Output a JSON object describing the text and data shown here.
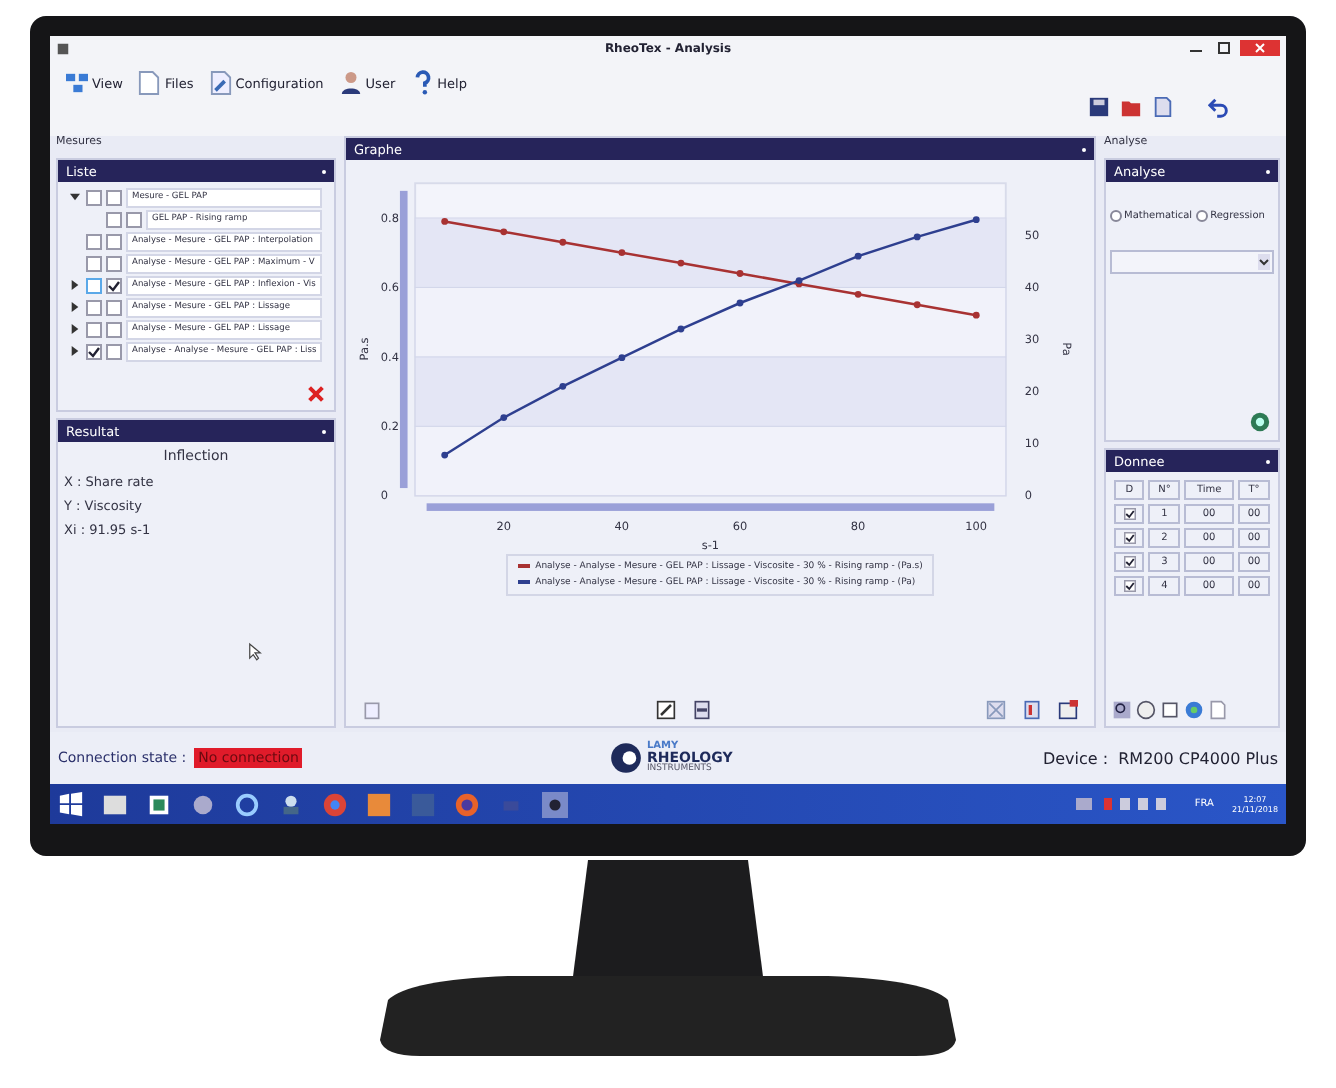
{
  "window": {
    "title": "RheoTex - Analysis"
  },
  "menu": [
    {
      "label": "View"
    },
    {
      "label": "Files"
    },
    {
      "label": "Configuration"
    },
    {
      "label": "User"
    },
    {
      "label": "Help"
    }
  ],
  "mesures_label": "Mesures",
  "liste": {
    "title": "Liste",
    "items": [
      {
        "label": "Mesure - GEL PAP",
        "checks": [
          false,
          false
        ],
        "expanded": true,
        "selected": false,
        "children": [
          {
            "label": "GEL PAP - Rising ramp",
            "checks": [
              false,
              false
            ],
            "selected": false
          }
        ]
      },
      {
        "label": "Analyse - Mesure - GEL PAP : Interpolation",
        "checks": [
          false,
          false
        ],
        "selected": false
      },
      {
        "label": "Analyse - Mesure - GEL PAP : Maximum - V",
        "checks": [
          false,
          false
        ],
        "selected": false
      },
      {
        "label": "Analyse - Mesure - GEL PAP : Inflexion - Vis",
        "checks": [
          false,
          true
        ],
        "expanded": false,
        "selected": true
      },
      {
        "label": "Analyse - Mesure - GEL PAP : Lissage",
        "checks": [
          false,
          false
        ],
        "expanded": false,
        "selected": false
      },
      {
        "label": "Analyse - Mesure - GEL PAP : Lissage",
        "checks": [
          false,
          false
        ],
        "expanded": false,
        "selected": false
      },
      {
        "label": "Analyse - Analyse - Mesure - GEL PAP : Liss",
        "checks": [
          true,
          false
        ],
        "expanded": false,
        "selected": false
      }
    ]
  },
  "resultat": {
    "title": "Resultat",
    "heading": "Inflection",
    "lines": [
      "X : Share rate",
      "Y : Viscosity",
      "Xi : 91.95 s-1"
    ]
  },
  "graph": {
    "title": "Graphe",
    "chart_data": {
      "type": "line",
      "xlabel": "s-1",
      "ylabel": "Pa.s",
      "y2label": "Pa",
      "x": [
        10,
        20,
        30,
        40,
        50,
        60,
        70,
        80,
        90,
        100
      ],
      "xlim": [
        5,
        105
      ],
      "ylim": [
        0,
        0.9
      ],
      "y2lim": [
        0,
        60
      ],
      "xticks": [
        20,
        40,
        60,
        80,
        100
      ],
      "yticks": [
        0,
        0.2,
        0.4,
        0.6,
        0.8
      ],
      "y2ticks": [
        0,
        10,
        20,
        30,
        40,
        50
      ],
      "series": [
        {
          "name": "Analyse - Analyse - Mesure - GEL PAP : Lissage - Viscosite - 30 % - Rising ramp - (Pa.s)",
          "color": "#a83232",
          "marker": "circle",
          "values": [
            0.79,
            0.76,
            0.73,
            0.7,
            0.67,
            0.64,
            0.61,
            0.58,
            0.55,
            0.52
          ]
        },
        {
          "name": "Analyse - Analyse - Mesure - GEL PAP : Lissage - Viscosite - 30 % - Rising ramp - (Pa)",
          "color": "#2e3f8f",
          "axis": "y2",
          "marker": "circle",
          "values": [
            7.8,
            15,
            21,
            26.5,
            32,
            37,
            41.3,
            46,
            49.7,
            53
          ]
        }
      ]
    }
  },
  "analyse_label": "Analyse",
  "analyse": {
    "title": "Analyse",
    "options": [
      {
        "label": "Mathematical",
        "selected": false
      },
      {
        "label": "Regression",
        "selected": false
      }
    ]
  },
  "donnee": {
    "title": "Donnee",
    "columns": [
      "D",
      "N°",
      "Time",
      "T°"
    ],
    "rows": [
      {
        "checked": true,
        "cells": [
          "",
          "1",
          "00",
          "00"
        ]
      },
      {
        "checked": true,
        "cells": [
          "",
          "2",
          "00",
          "00"
        ]
      },
      {
        "checked": true,
        "cells": [
          "",
          "3",
          "00",
          "00"
        ]
      },
      {
        "checked": true,
        "cells": [
          "",
          "4",
          "00",
          "00"
        ]
      }
    ]
  },
  "status": {
    "label": "Connection state :",
    "connection": "No connection",
    "logo_top": "LAMY",
    "logo_main": "RHEOLOGY",
    "logo_sub": "INSTRUMENTS",
    "device": "Device :  RM200 CP4000 Plus"
  },
  "taskbar": {
    "language": "FRA",
    "time": "12:07",
    "date": "21/11/2018"
  }
}
